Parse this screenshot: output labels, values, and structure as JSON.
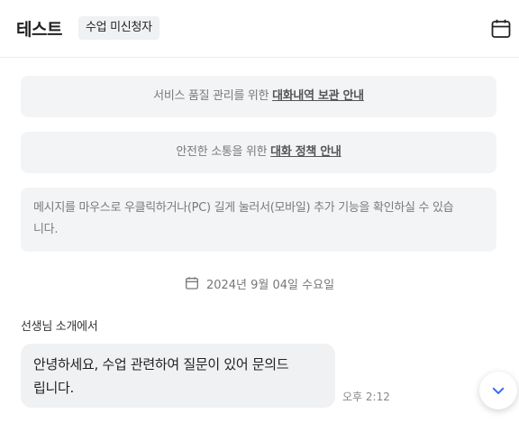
{
  "header": {
    "title": "테스트",
    "badge": "수업 미신청자",
    "calendar_icon": "calendar-icon"
  },
  "notices": [
    {
      "prefix": "서비스 품질 관리를 위한 ",
      "link": "대화내역 보관 안내"
    },
    {
      "prefix": "안전한 소통을 위한 ",
      "link": "대화 정책 안내"
    }
  ],
  "tip": {
    "line1": "메시지를 마우스로 우클릭하거나(PC) 길게 눌러서(모바일) 추가 기능을 확인하실 수 있습",
    "line2": "니다."
  },
  "date_divider": {
    "icon": "calendar-icon",
    "text": "2024년 9월 04일 수요일"
  },
  "message": {
    "sender": "선생님 소개에서",
    "line1": "안녕하세요, 수업 관련하여 질문이 있어 문의드",
    "line2": "립니다.",
    "time": "오후 2:12"
  },
  "scroll_button": {
    "icon": "chevron-down-icon"
  },
  "colors": {
    "accent": "#3b6ef5",
    "bubble": "#f0f1f3",
    "notice_bg": "#f3f4f6"
  }
}
